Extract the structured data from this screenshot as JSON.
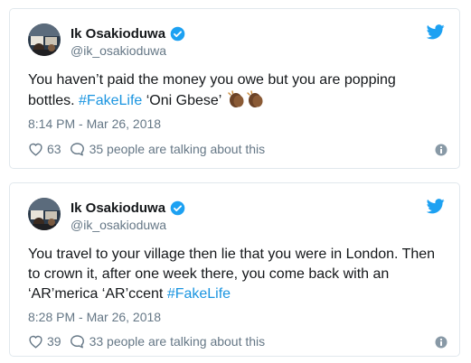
{
  "tweets": [
    {
      "display_name": "Ik Osakioduwa",
      "handle": "@ik_osakioduwa",
      "text_before": "You haven’t paid the money you owe but you are popping bottles. ",
      "hashtag": "#FakeLife",
      "text_after": " ‘Oni Gbese’ ",
      "emoji": "clapping-hands-dark-skin",
      "timestamp": "8:14 PM - Mar 26, 2018",
      "likes": "63",
      "talking": "35 people are talking about this"
    },
    {
      "display_name": "Ik Osakioduwa",
      "handle": "@ik_osakioduwa",
      "text_before": "You travel to your village then lie that you were in London. Then to crown it, after one week there, you come back with an ‘AR’merica ‘AR’ccent ",
      "hashtag": "#FakeLife",
      "text_after": "",
      "timestamp": "8:28 PM - Mar 26, 2018",
      "likes": "39",
      "talking": "33 people are talking about this"
    }
  ],
  "colors": {
    "accent": "#1b95e0",
    "twitter_blue": "#1da1f2",
    "muted_text": "#657786",
    "border": "#e1e8ed"
  },
  "icons": [
    "verified-badge-icon",
    "twitter-bird-icon",
    "heart-icon",
    "comment-icon",
    "info-icon"
  ]
}
